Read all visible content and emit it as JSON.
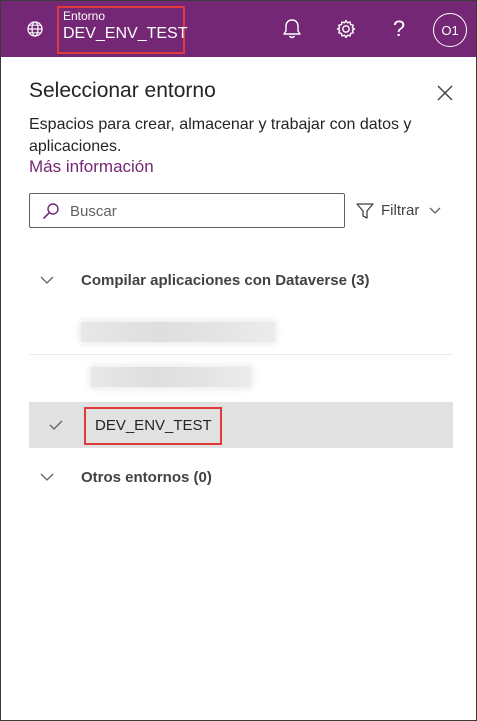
{
  "header": {
    "env_label": "Entorno",
    "env_value": "DEV_ENV_TEST",
    "avatar_initials": "O1",
    "help_glyph": "?",
    "icons": [
      "globe-icon",
      "bell-icon",
      "gear-icon",
      "help-icon"
    ]
  },
  "panel": {
    "title": "Seleccionar entorno",
    "description": "Espacios para crear, almacenar y trabajar con datos y aplicaciones.",
    "link": "Más información"
  },
  "search": {
    "placeholder": "Buscar"
  },
  "filter": {
    "label": "Filtrar"
  },
  "groups": [
    {
      "label": "Compilar aplicaciones con Dataverse (3)",
      "items": [
        {
          "label": "",
          "redacted": true
        },
        {
          "label": "",
          "redacted": true
        },
        {
          "label": "DEV_ENV_TEST",
          "selected": true
        }
      ]
    },
    {
      "label": "Otros entornos (0)",
      "items": []
    }
  ],
  "colors": {
    "brand": "#742774",
    "highlight_border": "#e03a3a",
    "selected_row": "#e1e1e1"
  }
}
